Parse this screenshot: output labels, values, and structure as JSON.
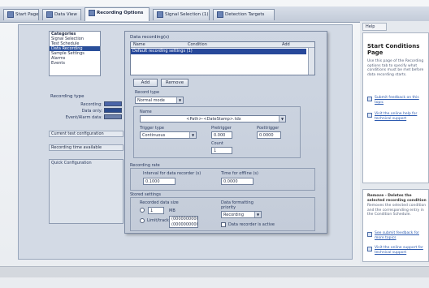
{
  "tabs": [
    {
      "label": "Start Page"
    },
    {
      "label": "Data View"
    },
    {
      "label": "Recording Options",
      "active": true
    },
    {
      "label": "Signal Selection (1)"
    },
    {
      "label": "Detection Targets"
    }
  ],
  "left": {
    "categories_title": "Categories",
    "categories": [
      "Signal Selection",
      "Test Schedule",
      "Data Recording",
      "Sample Settings",
      "Alarms",
      "Events"
    ],
    "selected_index": 2,
    "recording_group": "Recording type",
    "recording_labels": [
      "Recording:",
      "Data only:",
      "Event/Alarm data:"
    ],
    "swatch_colors": [
      "#4a64a8",
      "#2a4a8c",
      "#6b7fa9"
    ],
    "link1": "Current test configuration",
    "link2": "Recording time available",
    "box_title": "Quick Configuration"
  },
  "dialog": {
    "section_title": "Data recording(s)",
    "col_name": "Name",
    "col_condition": "Condition",
    "col_add": "Add",
    "selected_row": "Default recording settings (1)",
    "btn_add": "Add",
    "btn_remove": "Remove",
    "record_type_label": "Record type",
    "record_type_value": "Normal mode",
    "name_label": "Name",
    "name_value": "<Path>-<DateStamp>.tdx",
    "trigger_label": "Trigger type",
    "trigger_value": "Continuous",
    "pretrigger_label": "Pretrigger",
    "pretrigger_value": "0.000",
    "posttrigger_label": "Posttrigger",
    "posttrigger_value": "0.0000",
    "count_label": "Count",
    "count_value": "1",
    "interval_group": "Recording rate",
    "interval_left_label": "Interval for data recorder (s)",
    "interval_left_value": "0.1000",
    "interval_right_label": "Time for offline (s)",
    "interval_right_value": "0.0000",
    "storage_group": "Stored settings",
    "size_label": "Recorded data size",
    "size_value": "1",
    "size_unit": "MB",
    "file_label": "Limit/tracking",
    "file_value1": "(0000000000)",
    "file_value2": "(0000000000)",
    "mode_label": "Data formatting",
    "mode_label2": "priority",
    "mode_value": "Recording",
    "check_label": "Data recorder is active"
  },
  "help": {
    "tab": "Help",
    "title": "Start Conditions Page",
    "body": "Use this page of the Recording options tab to specify what conditions must be met before data recording starts.",
    "link1": "Submit feedback on this topic",
    "link2": "Visit the online help for technical support",
    "box2_title": "Remove - Deletes the selected recording condition",
    "box2_body": "Removes the selected condition and the corresponding entry in the Condition Schedule.",
    "box2_link1": "See submit feedback for more topics",
    "box2_link2": "Visit the online support for technical support"
  }
}
